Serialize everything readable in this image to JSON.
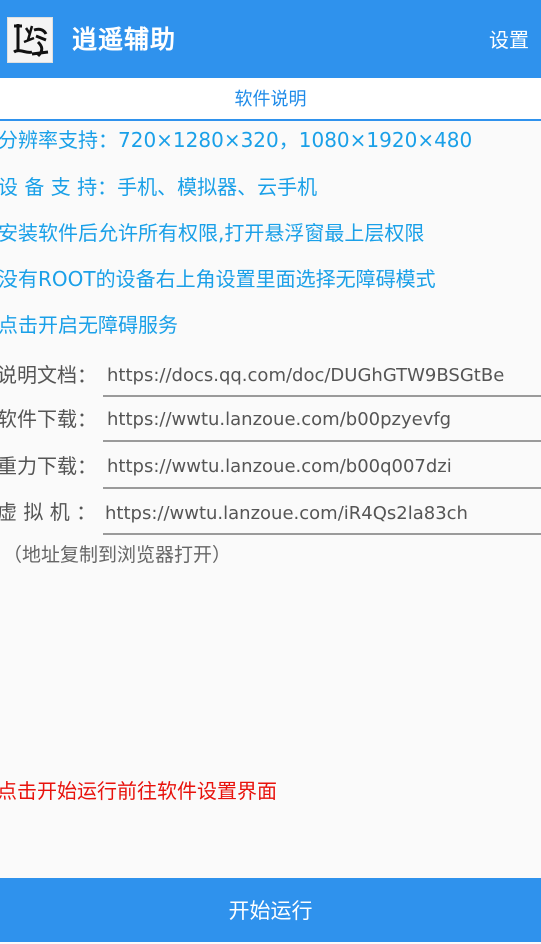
{
  "app": {
    "title": "逍遥辅助",
    "settings_label": "设置",
    "logo_name": "app-logo"
  },
  "section": {
    "title": "软件说明"
  },
  "info_lines": [
    "分辨率支持：720×1280×320，1080×1920×480",
    "设 备 支 持：手机、模拟器、云手机",
    "安装软件后允许所有权限,打开悬浮窗最上层权限",
    "没有ROOT的设备右上角设置里面选择无障碍模式",
    "点击开启无障碍服务"
  ],
  "links": [
    {
      "label": "说明文档：",
      "value": "https://docs.qq.com/doc/DUGhGTW9BSGtBe"
    },
    {
      "label": "软件下载：",
      "value": "https://wwtu.lanzoue.com/b00pzyevfg"
    },
    {
      "label": "重力下载：",
      "value": "https://wwtu.lanzoue.com/b00q007dzi"
    },
    {
      "label": "虚 拟 机 ：",
      "value": "https://wwtu.lanzoue.com/iR4Qs2la83ch"
    }
  ],
  "hint": "（地址复制到浏览器打开）",
  "red_hint": "点击开始运行前往软件设置界面",
  "start_button": "开始运行",
  "colors": {
    "primary": "#2f92ed",
    "info_text": "#1aa0e8",
    "warning_text": "#e8120c"
  }
}
